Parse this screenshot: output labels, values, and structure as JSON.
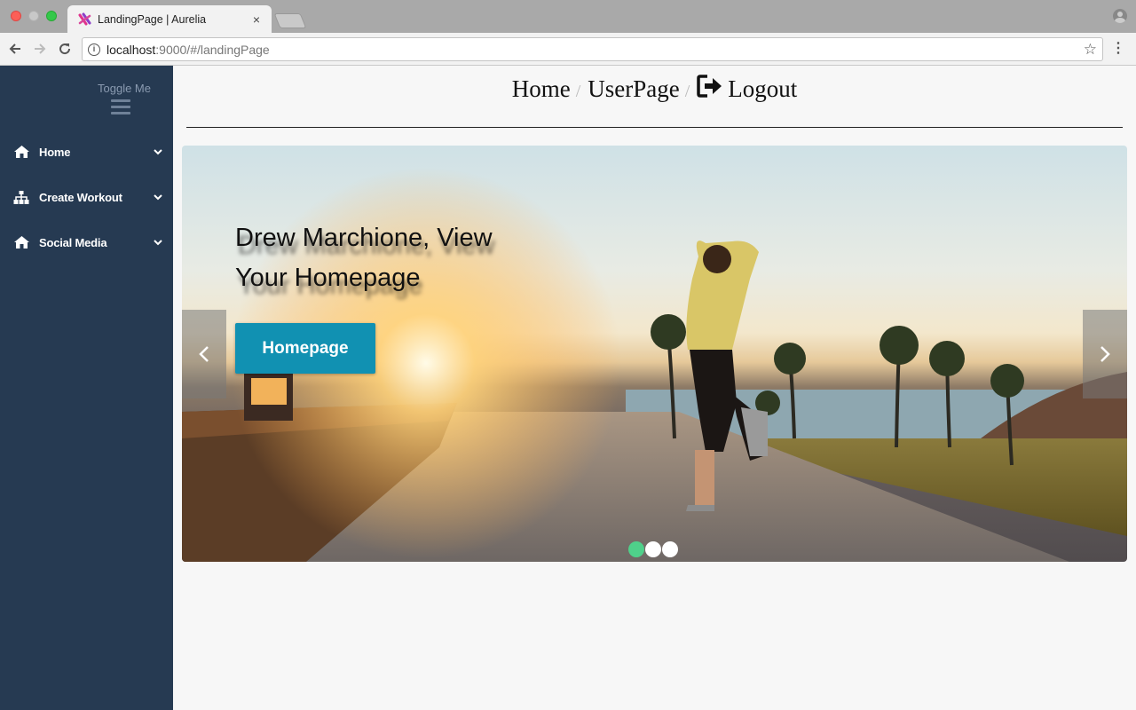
{
  "browser": {
    "tab_title": "LandingPage | Aurelia",
    "tab_close": "×",
    "url_host": "localhost",
    "url_rest": ":9000/#/landingPage",
    "icons": {
      "back": "arrow-left-icon",
      "forward": "arrow-right-icon",
      "reload": "reload-icon",
      "info": "info-icon",
      "star": "star-icon",
      "menu": "kebab-menu-icon",
      "profile": "profile-icon"
    }
  },
  "sidebar": {
    "toggle_label": "Toggle Me",
    "items": [
      {
        "label": "Home",
        "icon": "home-icon"
      },
      {
        "label": "Create Workout",
        "icon": "sitemap-icon"
      },
      {
        "label": "Social Media",
        "icon": "home-icon"
      }
    ]
  },
  "breadcrumb": {
    "items": [
      "Home",
      "UserPage",
      "Logout"
    ],
    "separator": "/"
  },
  "carousel": {
    "caption": "Drew Marchione, View Your Homepage",
    "button_label": "Homepage",
    "slides": 3,
    "active_slide": 1
  },
  "colors": {
    "sidebar_bg": "#263a52",
    "button": "#1191b2",
    "active_dot": "#4fd08a"
  }
}
